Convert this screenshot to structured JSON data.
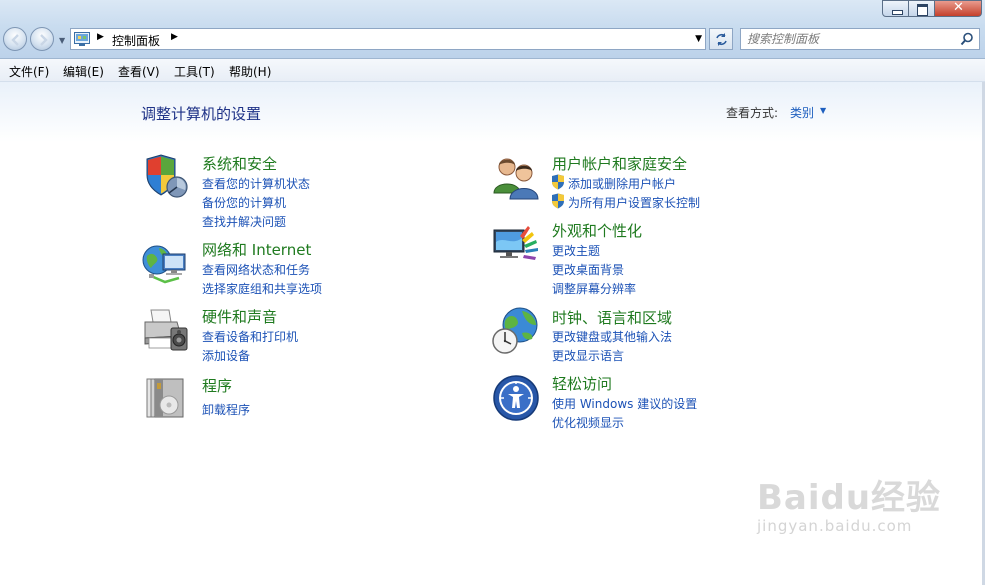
{
  "window": {
    "title_controls": {
      "minimize": "minimize",
      "maximize": "maximize",
      "close": "close"
    }
  },
  "nav": {
    "back": "back",
    "forward": "forward"
  },
  "address": {
    "crumb": "控制面板"
  },
  "search": {
    "placeholder": "搜索控制面板"
  },
  "menu": [
    "文件(F)",
    "编辑(E)",
    "查看(V)",
    "工具(T)",
    "帮助(H)"
  ],
  "page": {
    "heading": "调整计算机的设置",
    "view_by_label": "查看方式:",
    "view_by_value": "类别"
  },
  "categories": [
    {
      "title": "系统和安全",
      "links": [
        "查看您的计算机状态",
        "备份您的计算机",
        "查找并解决问题"
      ],
      "icon": "shield-icon"
    },
    {
      "title": "网络和 Internet",
      "links": [
        "查看网络状态和任务",
        "选择家庭组和共享选项"
      ],
      "icon": "network-icon"
    },
    {
      "title": "硬件和声音",
      "links": [
        "查看设备和打印机",
        "添加设备"
      ],
      "icon": "printer-icon"
    },
    {
      "title": "程序",
      "links": [
        "卸载程序"
      ],
      "icon": "programs-icon"
    },
    {
      "title": "用户帐户和家庭安全",
      "links": [
        "添加或删除用户帐户",
        "为所有用户设置家长控制"
      ],
      "icon": "users-icon"
    },
    {
      "title": "外观和个性化",
      "links": [
        "更改主题",
        "更改桌面背景",
        "调整屏幕分辨率"
      ],
      "icon": "appearance-icon"
    },
    {
      "title": "时钟、语言和区域",
      "links": [
        "更改键盘或其他输入法",
        "更改显示语言"
      ],
      "icon": "clock-globe-icon"
    },
    {
      "title": "轻松访问",
      "links": [
        "使用 Windows 建议的设置",
        "优化视频显示"
      ],
      "icon": "ease-of-access-icon"
    }
  ],
  "watermark": {
    "logo": "Baidu经验",
    "url": "jingyan.baidu.com"
  },
  "colors": {
    "category_title": "#1f7a1f",
    "link": "#1c52b6",
    "heading": "#1e3287"
  }
}
